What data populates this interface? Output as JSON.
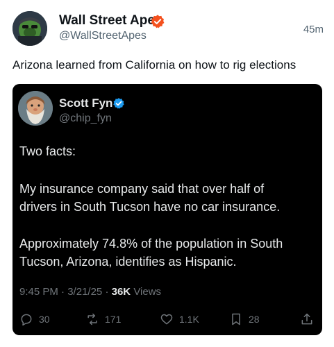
{
  "post": {
    "display_name": "Wall Street Apes",
    "handle": "@WallStreetApes",
    "time": "45m",
    "text": "Arizona learned from California on how to rig elections",
    "badge_color": "#f4511e"
  },
  "quote": {
    "display_name": "Scott Fyn",
    "handle": "@chip_fyn",
    "badge_color": "#1d9bf0",
    "lines": [
      "Two facts:",
      "My insurance company said that over half of",
      "drivers in South Tucson have no car insurance.",
      "Approximately 74.8% of the population in South",
      "Tucson, Arizona, identifies as Hispanic."
    ],
    "meta": {
      "time": "9:45 PM",
      "sep1": "·",
      "date": "3/21/25",
      "sep2": "·",
      "views_count": "36K",
      "views_label": "Views"
    },
    "actions": {
      "replies": "30",
      "reposts": "171",
      "likes": "1.1K",
      "bookmarks": "28"
    },
    "icons": [
      "reply-icon",
      "repost-icon",
      "like-icon",
      "bookmark-icon",
      "share-icon"
    ]
  }
}
